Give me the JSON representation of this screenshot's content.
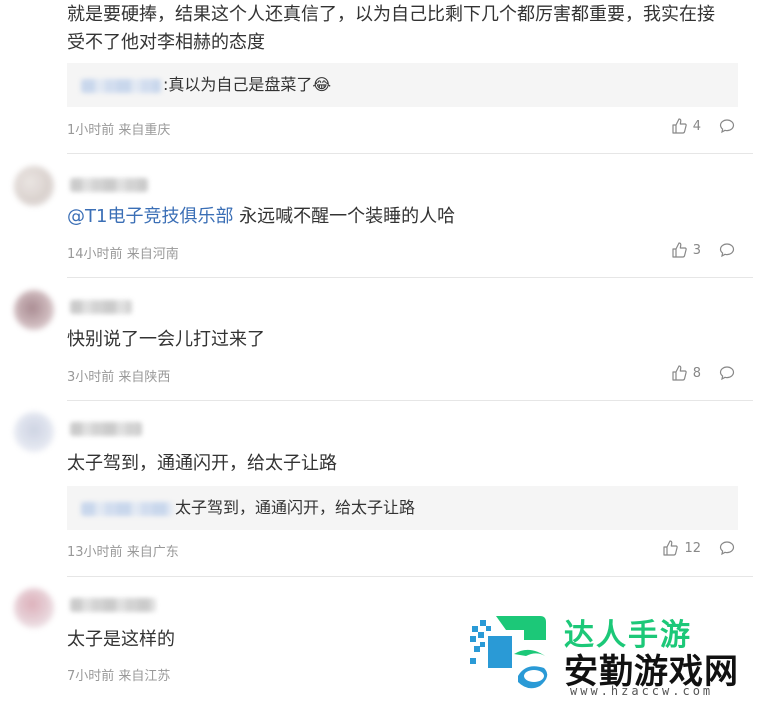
{
  "comments": [
    {
      "text": "就是要硬捧，结果这个人还真信了，以为自己比剩下几个都厉害都重要，我实在接受不了他对李相赫的态度",
      "reply": {
        "text": ":真以为自己是盘菜了😂"
      },
      "time": "1小时前",
      "location": "来自重庆",
      "likes": "4"
    },
    {
      "mention": "@T1电子竞技俱乐部",
      "text": " 永远喊不醒一个装睡的人哈",
      "time": "14小时前",
      "location": "来自河南",
      "likes": "3"
    },
    {
      "text": "快别说了一会儿打过来了",
      "time": "3小时前",
      "location": "来自陕西",
      "likes": "8"
    },
    {
      "text": "太子驾到，通通闪开，给太子让路",
      "reply": {
        "text": "太子驾到，通通闪开，给太子让路"
      },
      "time": "13小时前",
      "location": "来自广东",
      "likes": "12"
    },
    {
      "text": "太子是这样的",
      "time": "7小时前",
      "location": "来自江苏"
    }
  ],
  "watermark": {
    "title": "达人手游",
    "subtitle": "安勤游戏网",
    "url": "www.hzaccw.com"
  },
  "colors": {
    "mention": "#3b6fb6",
    "meta": "#999999",
    "reply_bg": "#f5f5f5",
    "brand_green": "#1cc878"
  }
}
